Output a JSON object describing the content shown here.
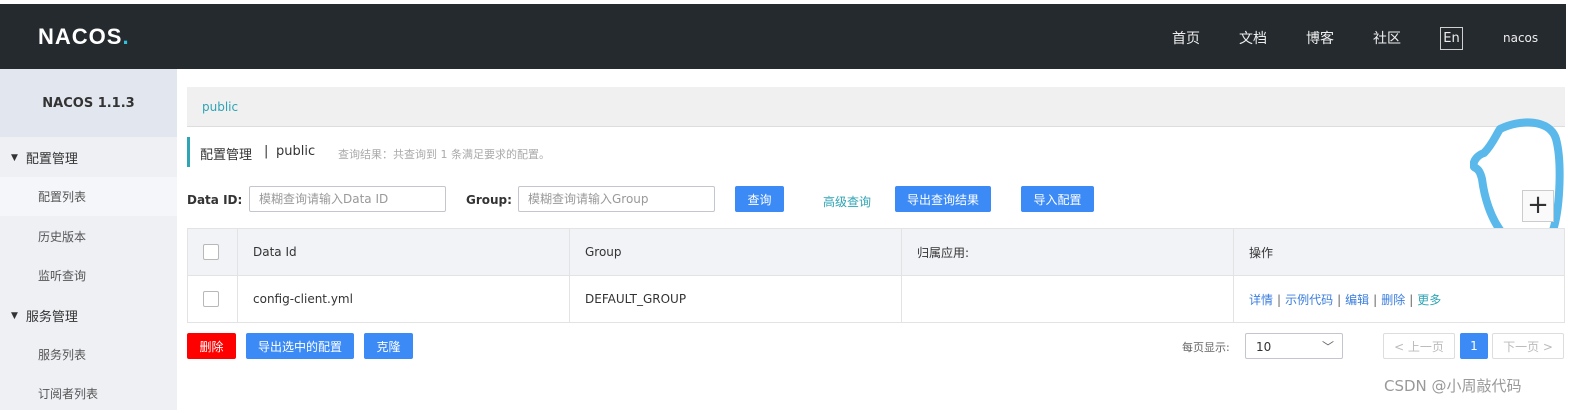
{
  "header": {
    "logo_prefix": "NACOS",
    "logo_dot": ".",
    "nav": [
      "首页",
      "文档",
      "博客",
      "社区"
    ],
    "lang": "En",
    "user": "nacos"
  },
  "sidebar": {
    "title": "NACOS 1.1.3",
    "groups": [
      {
        "label": "配置管理",
        "items": [
          "配置列表",
          "历史版本",
          "监听查询"
        ]
      },
      {
        "label": "服务管理",
        "items": [
          "服务列表",
          "订阅者列表"
        ]
      }
    ]
  },
  "breadcrumb": {
    "namespace": "public"
  },
  "page": {
    "title": "配置管理",
    "sep": "|",
    "namespace": "public",
    "query_result": "查询结果：共查询到 1 条满足要求的配置。"
  },
  "search": {
    "dataid_label": "Data ID:",
    "dataid_placeholder": "模糊查询请输入Data ID",
    "group_label": "Group:",
    "group_placeholder": "模糊查询请输入Group",
    "query_button": "查询",
    "advanced_link": "高级查询",
    "export_button": "导出查询结果",
    "import_button": "导入配置",
    "add_button": "+"
  },
  "table": {
    "headers": [
      "Data Id",
      "Group",
      "归属应用:",
      "操作"
    ],
    "rows": [
      {
        "data_id": "config-client.yml",
        "group": "DEFAULT_GROUP",
        "app": ""
      }
    ],
    "ops": [
      "详情",
      "示例代码",
      "编辑",
      "删除",
      "更多"
    ]
  },
  "footer": {
    "delete_button": "删除",
    "export_selected_button": "导出选中的配置",
    "clone_button": "克隆",
    "page_size_label": "每页显示:",
    "page_size": "10",
    "prev": "< 上一页",
    "current_page": "1",
    "next": "下一页 >"
  },
  "watermark": "CSDN @小周敲代码",
  "colors": {
    "accent": "#2fa4b5",
    "primary": "#3b8af5",
    "danger": "#ff0000",
    "annotation": "#5ab8ea"
  }
}
